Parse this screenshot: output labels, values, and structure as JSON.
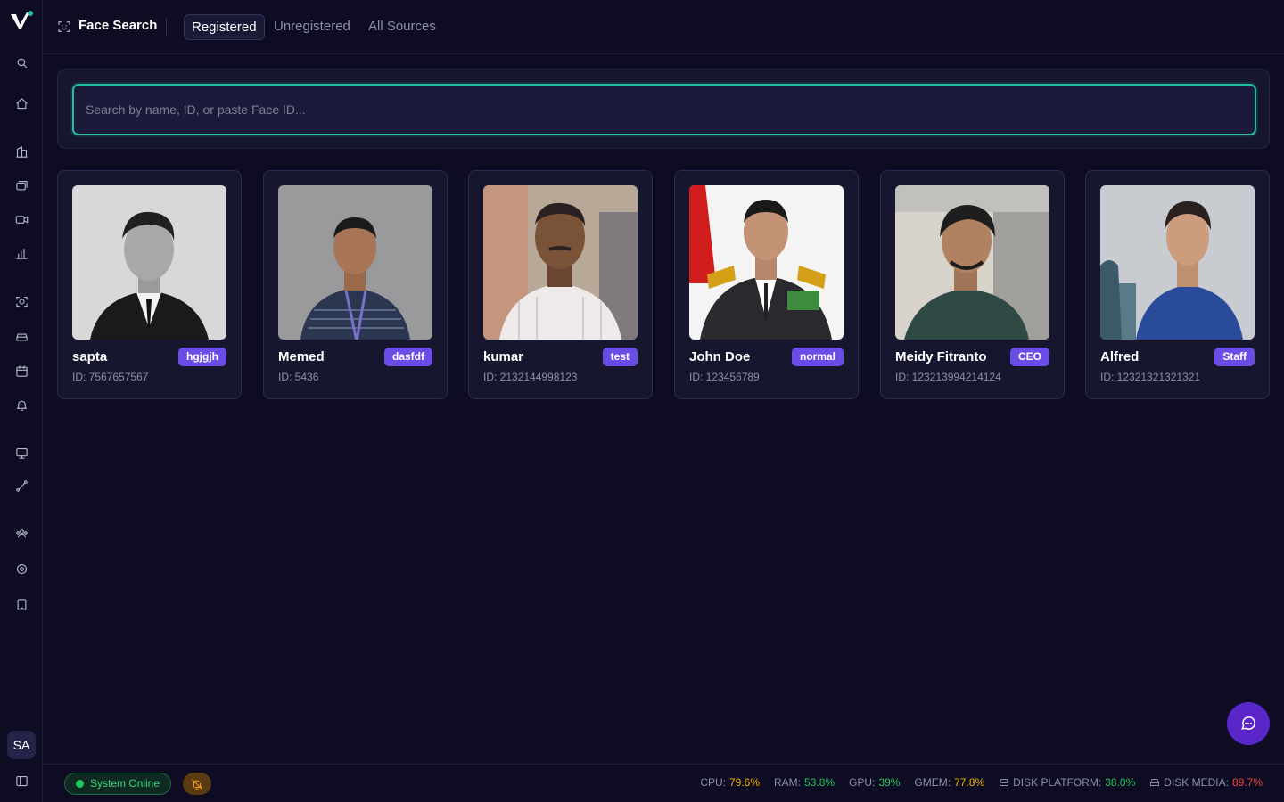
{
  "header": {
    "title": "Face Search",
    "tabs": [
      {
        "label": "Registered",
        "active": true
      },
      {
        "label": "Unregistered",
        "active": false
      },
      {
        "label": "All Sources",
        "active": false
      }
    ]
  },
  "sidebar": {
    "icons": [
      "search-icon",
      "home-icon",
      "building-icon",
      "cameras-icon",
      "video-icon",
      "bar-chart-icon",
      "face-scan-icon",
      "car-icon",
      "calendar-icon",
      "bell-icon",
      "monitor-icon",
      "route-icon",
      "users-icon",
      "settings-icon",
      "tablet-icon"
    ],
    "avatar_initials": "SA"
  },
  "search": {
    "placeholder": "Search by name, ID, or paste Face ID..."
  },
  "persons": [
    {
      "name": "sapta",
      "badge": "hgjgjh",
      "id": "ID: 7567657567"
    },
    {
      "name": "Memed",
      "badge": "dasfdf",
      "id": "ID: 5436"
    },
    {
      "name": "kumar",
      "badge": "test",
      "id": "ID: 2132144998123"
    },
    {
      "name": "John Doe",
      "badge": "normal",
      "id": "ID: 123456789"
    },
    {
      "name": "Meidy Fitranto",
      "badge": "CEO",
      "id": "ID: 123213994214124"
    },
    {
      "name": "Alfred",
      "badge": "Staff",
      "id": "ID: 12321321321321"
    }
  ],
  "status": {
    "system": "System Online",
    "metrics": [
      {
        "label": "CPU:",
        "value": "79.6%",
        "level": "warning"
      },
      {
        "label": "RAM:",
        "value": "53.8%",
        "level": "ok"
      },
      {
        "label": "GPU:",
        "value": "39%",
        "level": "ok"
      },
      {
        "label": "GMEM:",
        "value": "77.8%",
        "level": "warning"
      },
      {
        "label": "DISK PLATFORM:",
        "value": "38.0%",
        "level": "ok"
      },
      {
        "label": "DISK MEDIA:",
        "value": "89.7%",
        "level": "critical"
      }
    ]
  },
  "colors": {
    "accent": "#1fbf9f",
    "badge": "#6a4de6",
    "ok": "#22c55e",
    "warning": "#f0b400",
    "critical": "#ef4444"
  }
}
